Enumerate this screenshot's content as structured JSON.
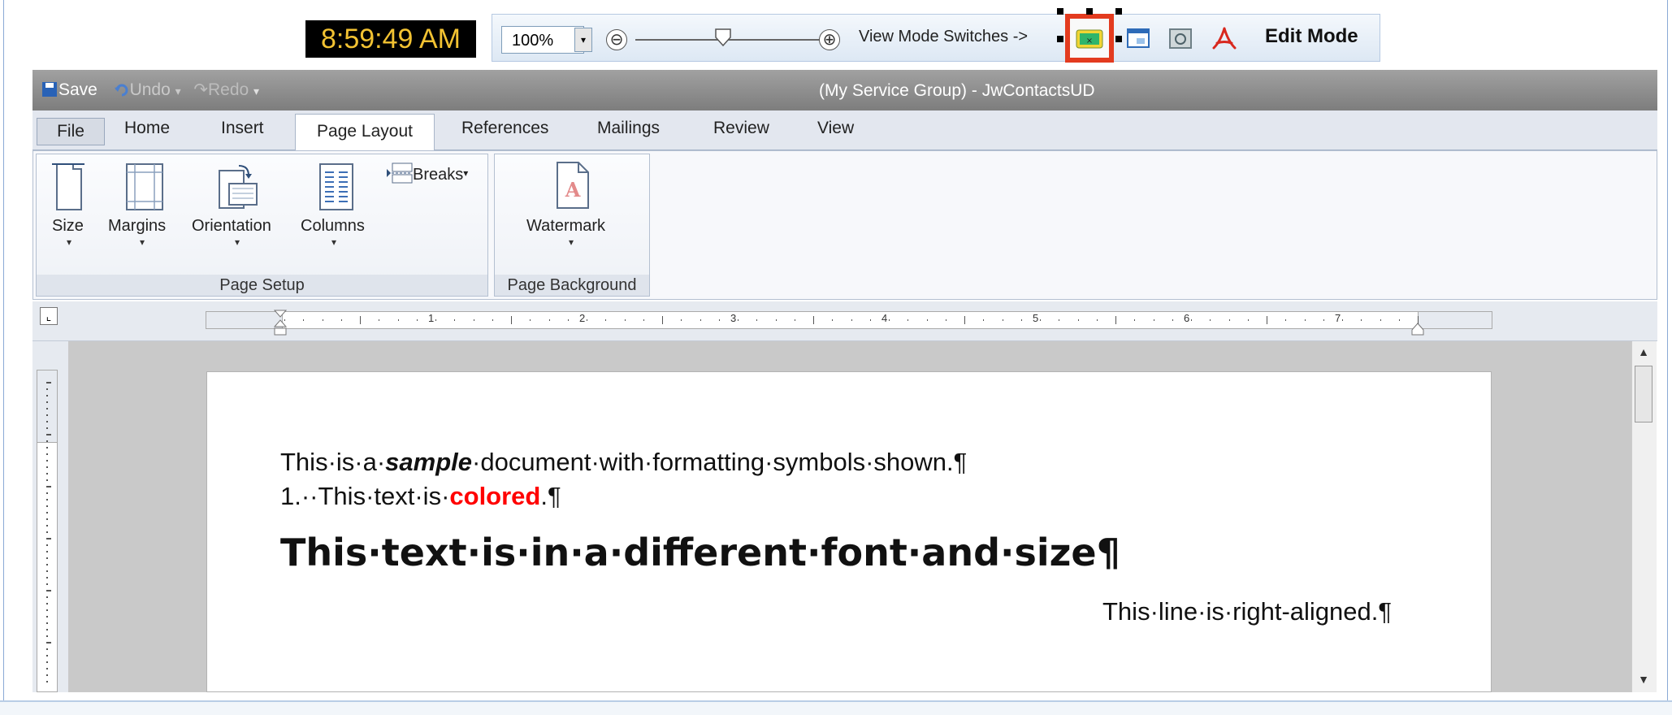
{
  "clock": "8:59:49 AM",
  "view_bar": {
    "zoom_value": "100%",
    "zoom_dropdown_icon": "chevron-down-icon",
    "zoom_out": "⊖",
    "zoom_in": "⊕",
    "zoom_level_fraction": 0.42,
    "view_mode_label": "View Mode Switches ->",
    "mode_icons": [
      "print-layout-icon",
      "web-layout-icon",
      "read-mode-icon",
      "pdf-icon"
    ],
    "edit_mode_label": "Edit Mode"
  },
  "titlebar": {
    "save_label": "Save",
    "undo_label": "Undo",
    "redo_label": "Redo",
    "title": "(My Service Group)  - JwContactsUD"
  },
  "tabs": [
    "File",
    "Home",
    "Insert",
    "Page Layout",
    "References",
    "Mailings",
    "Review",
    "View"
  ],
  "active_tab": "Page Layout",
  "ribbon": {
    "page_setup": {
      "buttons": [
        "Size",
        "Margins",
        "Orientation",
        "Columns"
      ],
      "breaks_label": "Breaks",
      "group_label": "Page Setup"
    },
    "page_background": {
      "watermark_label": "Watermark",
      "group_label": "Page Background"
    }
  },
  "ruler": {
    "numbers": [
      "1",
      "2",
      "3",
      "4",
      "5",
      "6",
      "7"
    ]
  },
  "document": {
    "line1": {
      "before": "This·is·a·",
      "emph": "sample",
      "after": "·document·with·formatting·symbols·shown.¶"
    },
    "line2": {
      "before": "1.··This·text·is·",
      "colored": "colored",
      "after": ".¶"
    },
    "line3": "This·text·is·in·a·different·font·and·size¶",
    "line4": "This·line·is·right-aligned.¶"
  },
  "colors": {
    "clock_text": "#f2c232",
    "selected_border": "#e33b1f",
    "colored_text": "#ff0000",
    "pdf_icon": "#d8281e",
    "titlebar": "#8c8c8c"
  }
}
